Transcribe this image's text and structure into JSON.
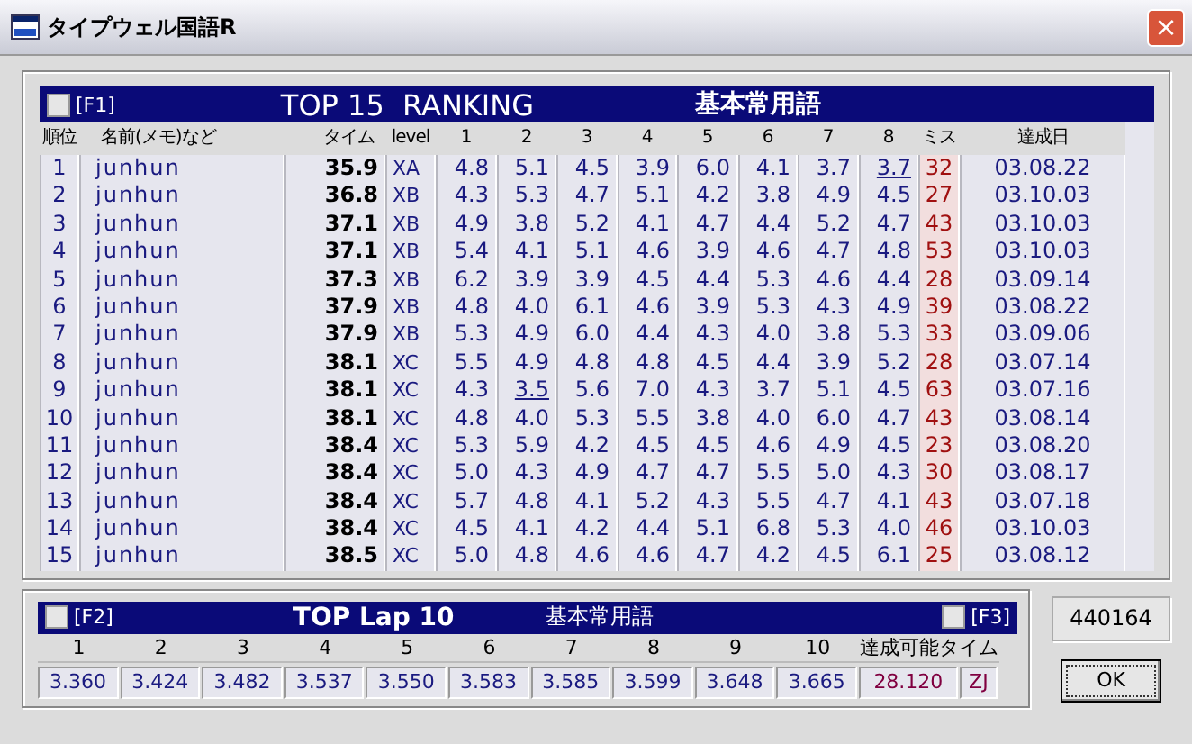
{
  "window": {
    "title": "タイプウェル国語R",
    "close": "×"
  },
  "ranking": {
    "hotkey": "[F1]",
    "checked": false,
    "title": "TOP 15  RANKING",
    "category": "基本常用語",
    "columns": [
      "順位",
      "名前(メモ)など",
      "タイム",
      "level",
      "1",
      "2",
      "3",
      "4",
      "5",
      "6",
      "7",
      "8",
      "ミス",
      "達成日"
    ],
    "rows": [
      {
        "rank": "1",
        "name": "junhun",
        "time": "35.9",
        "level": "XA",
        "laps": [
          {
            "v": "4.8",
            "underlined": false
          },
          {
            "v": "5.1",
            "underlined": false
          },
          {
            "v": "4.5",
            "underlined": false
          },
          {
            "v": "3.9",
            "underlined": false
          },
          {
            "v": "6.0",
            "underlined": false
          },
          {
            "v": "4.1",
            "underlined": false
          },
          {
            "v": "3.7",
            "underlined": false
          },
          {
            "v": "3.7",
            "underlined": true
          }
        ],
        "miss": "32",
        "date": "03.08.22"
      },
      {
        "rank": "2",
        "name": "junhun",
        "time": "36.8",
        "level": "XB",
        "laps": [
          {
            "v": "4.3",
            "underlined": false
          },
          {
            "v": "5.3",
            "underlined": false
          },
          {
            "v": "4.7",
            "underlined": false
          },
          {
            "v": "5.1",
            "underlined": false
          },
          {
            "v": "4.2",
            "underlined": false
          },
          {
            "v": "3.8",
            "underlined": false
          },
          {
            "v": "4.9",
            "underlined": false
          },
          {
            "v": "4.5",
            "underlined": false
          }
        ],
        "miss": "27",
        "date": "03.10.03"
      },
      {
        "rank": "3",
        "name": "junhun",
        "time": "37.1",
        "level": "XB",
        "laps": [
          {
            "v": "4.9",
            "underlined": false
          },
          {
            "v": "3.8",
            "underlined": false
          },
          {
            "v": "5.2",
            "underlined": false
          },
          {
            "v": "4.1",
            "underlined": false
          },
          {
            "v": "4.7",
            "underlined": false
          },
          {
            "v": "4.4",
            "underlined": false
          },
          {
            "v": "5.2",
            "underlined": false
          },
          {
            "v": "4.7",
            "underlined": false
          }
        ],
        "miss": "43",
        "date": "03.10.03"
      },
      {
        "rank": "4",
        "name": "junhun",
        "time": "37.1",
        "level": "XB",
        "laps": [
          {
            "v": "5.4",
            "underlined": false
          },
          {
            "v": "4.1",
            "underlined": false
          },
          {
            "v": "5.1",
            "underlined": false
          },
          {
            "v": "4.6",
            "underlined": false
          },
          {
            "v": "3.9",
            "underlined": false
          },
          {
            "v": "4.6",
            "underlined": false
          },
          {
            "v": "4.7",
            "underlined": false
          },
          {
            "v": "4.8",
            "underlined": false
          }
        ],
        "miss": "53",
        "date": "03.10.03"
      },
      {
        "rank": "5",
        "name": "junhun",
        "time": "37.3",
        "level": "XB",
        "laps": [
          {
            "v": "6.2",
            "underlined": false
          },
          {
            "v": "3.9",
            "underlined": false
          },
          {
            "v": "3.9",
            "underlined": false
          },
          {
            "v": "4.5",
            "underlined": false
          },
          {
            "v": "4.4",
            "underlined": false
          },
          {
            "v": "5.3",
            "underlined": false
          },
          {
            "v": "4.6",
            "underlined": false
          },
          {
            "v": "4.4",
            "underlined": false
          }
        ],
        "miss": "28",
        "date": "03.09.14"
      },
      {
        "rank": "6",
        "name": "junhun",
        "time": "37.9",
        "level": "XB",
        "laps": [
          {
            "v": "4.8",
            "underlined": false
          },
          {
            "v": "4.0",
            "underlined": false
          },
          {
            "v": "6.1",
            "underlined": false
          },
          {
            "v": "4.6",
            "underlined": false
          },
          {
            "v": "3.9",
            "underlined": false
          },
          {
            "v": "5.3",
            "underlined": false
          },
          {
            "v": "4.3",
            "underlined": false
          },
          {
            "v": "4.9",
            "underlined": false
          }
        ],
        "miss": "39",
        "date": "03.08.22"
      },
      {
        "rank": "7",
        "name": "junhun",
        "time": "37.9",
        "level": "XB",
        "laps": [
          {
            "v": "5.3",
            "underlined": false
          },
          {
            "v": "4.9",
            "underlined": false
          },
          {
            "v": "6.0",
            "underlined": false
          },
          {
            "v": "4.4",
            "underlined": false
          },
          {
            "v": "4.3",
            "underlined": false
          },
          {
            "v": "4.0",
            "underlined": false
          },
          {
            "v": "3.8",
            "underlined": false
          },
          {
            "v": "5.3",
            "underlined": false
          }
        ],
        "miss": "33",
        "date": "03.09.06"
      },
      {
        "rank": "8",
        "name": "junhun",
        "time": "38.1",
        "level": "XC",
        "laps": [
          {
            "v": "5.5",
            "underlined": false
          },
          {
            "v": "4.9",
            "underlined": false
          },
          {
            "v": "4.8",
            "underlined": false
          },
          {
            "v": "4.8",
            "underlined": false
          },
          {
            "v": "4.5",
            "underlined": false
          },
          {
            "v": "4.4",
            "underlined": false
          },
          {
            "v": "3.9",
            "underlined": false
          },
          {
            "v": "5.2",
            "underlined": false
          }
        ],
        "miss": "28",
        "date": "03.07.14"
      },
      {
        "rank": "9",
        "name": "junhun",
        "time": "38.1",
        "level": "XC",
        "laps": [
          {
            "v": "4.3",
            "underlined": false
          },
          {
            "v": "3.5",
            "underlined": true
          },
          {
            "v": "5.6",
            "underlined": false
          },
          {
            "v": "7.0",
            "underlined": false
          },
          {
            "v": "4.3",
            "underlined": false
          },
          {
            "v": "3.7",
            "underlined": false
          },
          {
            "v": "5.1",
            "underlined": false
          },
          {
            "v": "4.5",
            "underlined": false
          }
        ],
        "miss": "63",
        "date": "03.07.16"
      },
      {
        "rank": "10",
        "name": "junhun",
        "time": "38.1",
        "level": "XC",
        "laps": [
          {
            "v": "4.8",
            "underlined": false
          },
          {
            "v": "4.0",
            "underlined": false
          },
          {
            "v": "5.3",
            "underlined": false
          },
          {
            "v": "5.5",
            "underlined": false
          },
          {
            "v": "3.8",
            "underlined": false
          },
          {
            "v": "4.0",
            "underlined": false
          },
          {
            "v": "6.0",
            "underlined": false
          },
          {
            "v": "4.7",
            "underlined": false
          }
        ],
        "miss": "43",
        "date": "03.08.14"
      },
      {
        "rank": "11",
        "name": "junhun",
        "time": "38.4",
        "level": "XC",
        "laps": [
          {
            "v": "5.3",
            "underlined": false
          },
          {
            "v": "5.9",
            "underlined": false
          },
          {
            "v": "4.2",
            "underlined": false
          },
          {
            "v": "4.5",
            "underlined": false
          },
          {
            "v": "4.5",
            "underlined": false
          },
          {
            "v": "4.6",
            "underlined": false
          },
          {
            "v": "4.9",
            "underlined": false
          },
          {
            "v": "4.5",
            "underlined": false
          }
        ],
        "miss": "23",
        "date": "03.08.20"
      },
      {
        "rank": "12",
        "name": "junhun",
        "time": "38.4",
        "level": "XC",
        "laps": [
          {
            "v": "5.0",
            "underlined": false
          },
          {
            "v": "4.3",
            "underlined": false
          },
          {
            "v": "4.9",
            "underlined": false
          },
          {
            "v": "4.7",
            "underlined": false
          },
          {
            "v": "4.7",
            "underlined": false
          },
          {
            "v": "5.5",
            "underlined": false
          },
          {
            "v": "5.0",
            "underlined": false
          },
          {
            "v": "4.3",
            "underlined": false
          }
        ],
        "miss": "30",
        "date": "03.08.17"
      },
      {
        "rank": "13",
        "name": "junhun",
        "time": "38.4",
        "level": "XC",
        "laps": [
          {
            "v": "5.7",
            "underlined": false
          },
          {
            "v": "4.8",
            "underlined": false
          },
          {
            "v": "4.1",
            "underlined": false
          },
          {
            "v": "5.2",
            "underlined": false
          },
          {
            "v": "4.3",
            "underlined": false
          },
          {
            "v": "5.5",
            "underlined": false
          },
          {
            "v": "4.7",
            "underlined": false
          },
          {
            "v": "4.1",
            "underlined": false
          }
        ],
        "miss": "43",
        "date": "03.07.18"
      },
      {
        "rank": "14",
        "name": "junhun",
        "time": "38.4",
        "level": "XC",
        "laps": [
          {
            "v": "4.5",
            "underlined": false
          },
          {
            "v": "4.1",
            "underlined": false
          },
          {
            "v": "4.2",
            "underlined": false
          },
          {
            "v": "4.4",
            "underlined": false
          },
          {
            "v": "5.1",
            "underlined": false
          },
          {
            "v": "6.8",
            "underlined": false
          },
          {
            "v": "5.3",
            "underlined": false
          },
          {
            "v": "4.0",
            "underlined": false
          }
        ],
        "miss": "46",
        "date": "03.10.03"
      },
      {
        "rank": "15",
        "name": "junhun",
        "time": "38.5",
        "level": "XC",
        "laps": [
          {
            "v": "5.0",
            "underlined": false
          },
          {
            "v": "4.8",
            "underlined": false
          },
          {
            "v": "4.6",
            "underlined": false
          },
          {
            "v": "4.6",
            "underlined": false
          },
          {
            "v": "4.7",
            "underlined": false
          },
          {
            "v": "4.2",
            "underlined": false
          },
          {
            "v": "4.5",
            "underlined": false
          },
          {
            "v": "6.1",
            "underlined": false
          }
        ],
        "miss": "25",
        "date": "03.08.12"
      }
    ]
  },
  "lap_top": {
    "hotkey": "[F2]",
    "checked": false,
    "title": "TOP Lap 10",
    "category": "基本常用語",
    "hotkey_right": "[F3]",
    "checked_right": false,
    "columns": [
      "1",
      "2",
      "3",
      "4",
      "5",
      "6",
      "7",
      "8",
      "9",
      "10",
      "達成可能タイム"
    ],
    "values": [
      "3.360",
      "3.424",
      "3.482",
      "3.537",
      "3.550",
      "3.583",
      "3.585",
      "3.599",
      "3.648",
      "3.665",
      "28.120",
      "ZJ"
    ]
  },
  "counter": "440164",
  "ok_button": "OK"
}
